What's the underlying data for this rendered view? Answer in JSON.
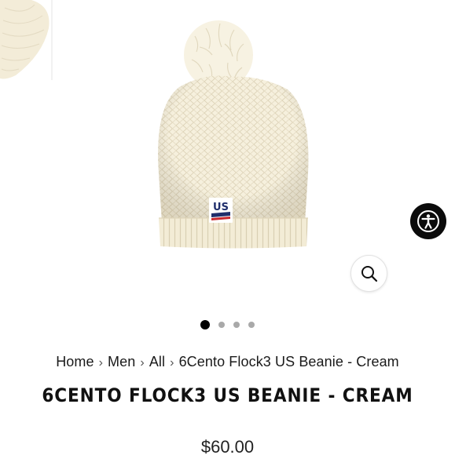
{
  "breadcrumb": {
    "items": [
      "Home",
      "Men",
      "All",
      "6Cento Flock3 US Beanie - Cream"
    ],
    "separator": "›"
  },
  "product": {
    "title": "6CENTO FLOCK3 US BEANIE - CREAM",
    "price": "$60.00"
  },
  "badge": {
    "text": "US"
  },
  "gallery": {
    "slides": 4,
    "active": 1
  },
  "icons": {
    "zoom": "magnifier-icon",
    "accessibility": "accessibility-person-icon"
  },
  "colors": {
    "beanie": "#f6f0dd",
    "badge_blue": "#1f2e6b",
    "badge_red": "#c8282e",
    "dot_active": "#000000",
    "dot_inactive": "#a9a9a9"
  }
}
